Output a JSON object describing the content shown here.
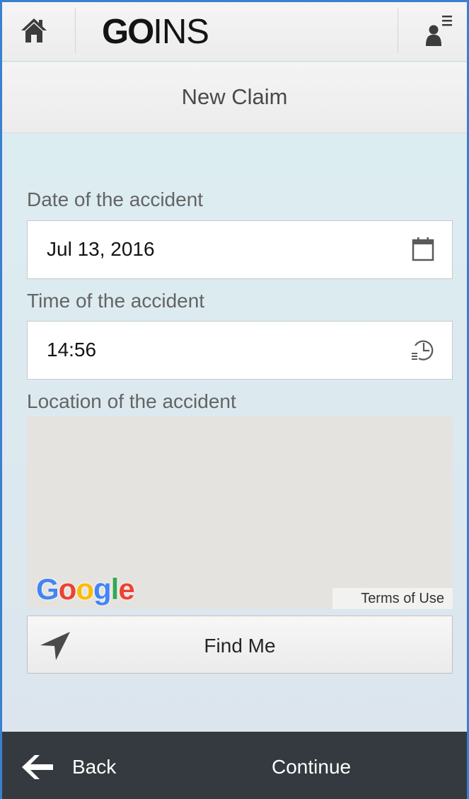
{
  "app": {
    "logo_bold": "GO",
    "logo_thin": "INS"
  },
  "header": {
    "title": "New Claim"
  },
  "form": {
    "date_label": "Date of the accident",
    "date_value": "Jul 13, 2016",
    "time_label": "Time of the accident",
    "time_value": "14:56",
    "location_label": "Location of the accident"
  },
  "map": {
    "provider_letters": [
      "G",
      "o",
      "o",
      "g",
      "l",
      "e"
    ],
    "terms_link": "Terms of Use"
  },
  "actions": {
    "find_me_label": "Find Me",
    "back_label": "Back",
    "continue_label": "Continue"
  },
  "colors": {
    "bottom_bar": "#343a40",
    "content_background": "#dceff2",
    "google_blue": "#4285f4",
    "google_red": "#ea4335",
    "google_yellow": "#fbbc05",
    "google_green": "#34a853"
  },
  "icons": {
    "home": "home-icon",
    "user_menu": "user-menu-icon",
    "calendar": "calendar-icon",
    "clock": "clock-icon",
    "location_arrow": "location-arrow-icon",
    "back_arrow": "arrow-left-icon"
  }
}
